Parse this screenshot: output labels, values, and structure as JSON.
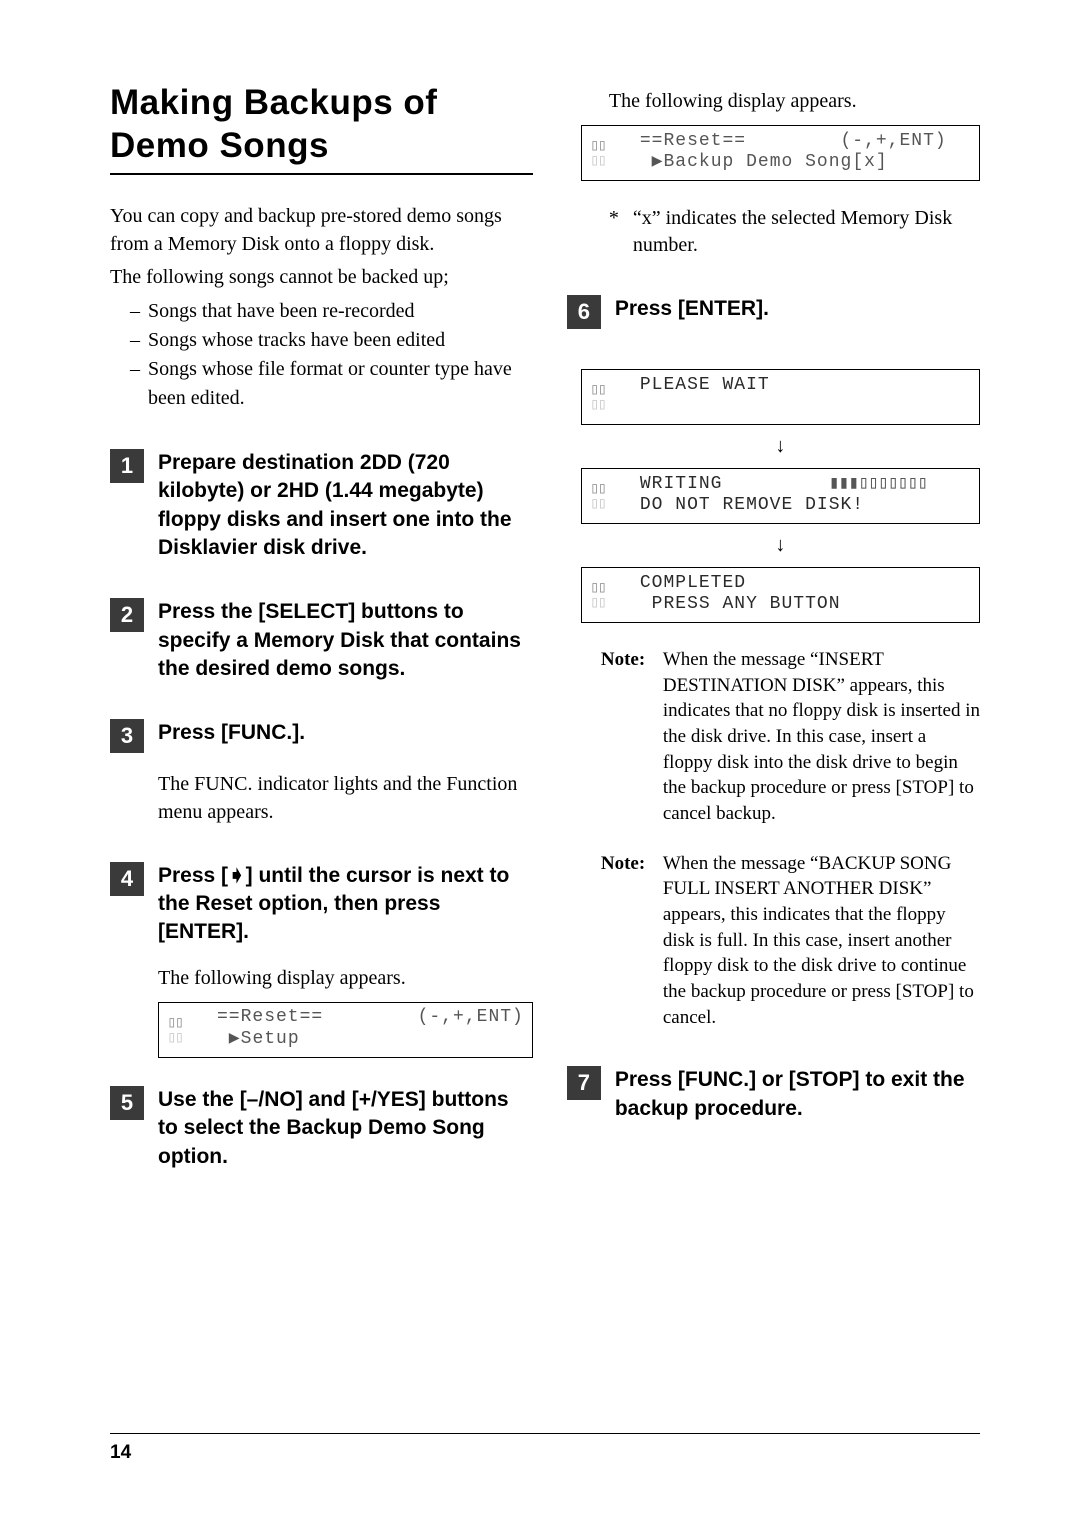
{
  "title": "Making Backups of Demo Songs",
  "intro_p1": "You can copy and backup pre-stored demo songs from a Memory Disk onto a floppy disk.",
  "intro_p2": "The following songs cannot be backed up;",
  "intro_list": [
    "Songs that have been re-recorded",
    "Songs whose tracks have been edited",
    "Songs whose file format or counter type have been edited."
  ],
  "steps": {
    "s1": {
      "n": "1",
      "t": "Prepare destination 2DD (720 kilobyte) or 2HD (1.44 megabyte) floppy disks and insert one into the Disklavier disk drive."
    },
    "s2": {
      "n": "2",
      "t": "Press the [SELECT] buttons to specify a Memory Disk that contains the desired demo songs."
    },
    "s3": {
      "n": "3",
      "t": "Press [FUNC.].",
      "sub": "The FUNC. indicator lights and the Function menu appears."
    },
    "s4": {
      "n": "4",
      "t": "Press [➧] until the cursor is next to the Reset option, then press [ENTER].",
      "sub": "The following display appears."
    },
    "s5": {
      "n": "5",
      "t": "Use the [–/NO] and [+/YES] buttons to select the Backup Demo Song option."
    },
    "s6": {
      "n": "6",
      "t": "Press [ENTER]."
    },
    "s7": {
      "n": "7",
      "t": "Press [FUNC.] or [STOP] to exit the backup procedure."
    }
  },
  "right_intro": "The following display appears.",
  "lcd_reset_setup": "==Reset==        (-,+,ENT)\n ▶Setup",
  "lcd_reset_backup": "==Reset==        (-,+,ENT)\n ▶Backup Demo Song[x]",
  "lcd_wait": "PLEASE WAIT\n ",
  "lcd_writing_l1": "WRITING         ",
  "lcd_writing_bars": "▮▮▮▯▯▯▯▯▯▯",
  "lcd_writing_l2": "DO NOT REMOVE DISK!",
  "lcd_completed": "COMPLETED\n PRESS ANY BUTTON",
  "asterisk_note": "“x” indicates the selected Memory Disk number.",
  "note1": "When the message “INSERT DESTINATION DISK” appears, this indicates that no floppy disk is inserted in the disk drive. In this case, insert a floppy disk into the disk drive to begin the backup procedure or press [STOP] to cancel backup.",
  "note2": "When the message “BACKUP SONG FULL INSERT ANOTHER DISK” appears, this indicates that the floppy disk is full. In this case, insert another floppy disk to the disk drive to continue the backup procedure or press [STOP] to cancel.",
  "note_label": "Note:",
  "arrow": "↓",
  "ast": "*",
  "dash": "–",
  "page_number": "14"
}
